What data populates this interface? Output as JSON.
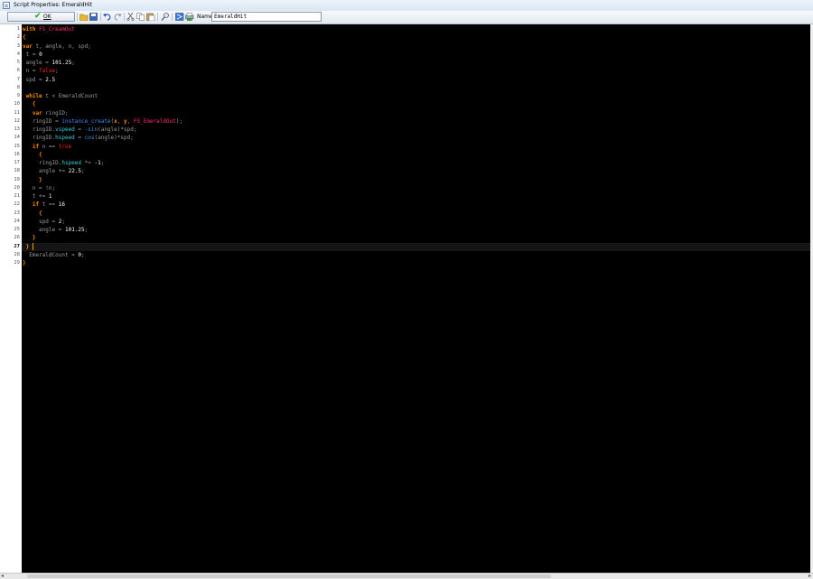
{
  "window": {
    "title": "Script Properties: EmeraldHit"
  },
  "toolbar": {
    "ok_label": "OK",
    "name_label": "Name:",
    "name_value": "EmeraldHit",
    "icons": [
      "open-icon",
      "save-icon",
      "undo-icon",
      "redo-icon",
      "cut-icon",
      "copy-icon",
      "paste-icon",
      "find-icon",
      "goto-line-icon",
      "print-icon"
    ]
  },
  "editor": {
    "current_line": 27,
    "colors": {
      "keyword": "#ff8a00",
      "number": "#ffffff",
      "object": "#ff2d6f",
      "constant": "#ff2020",
      "function": "#3d8bff",
      "variable": "#35d0e0",
      "plain": "#9a9a9a",
      "background": "#000000"
    },
    "lines": [
      [
        {
          "t": "with ",
          "c": "kw"
        },
        {
          "t": "FS_CreamOut",
          "c": "obj"
        }
      ],
      [
        {
          "t": "{",
          "c": "br"
        }
      ],
      [
        {
          "t": "var ",
          "c": "kw"
        },
        {
          "t": "t, angle, n, spd;",
          "c": "pl"
        }
      ],
      [
        {
          "t": " t = ",
          "c": "pl"
        },
        {
          "t": "0",
          "c": "num"
        }
      ],
      [
        {
          "t": " angle = ",
          "c": "pl"
        },
        {
          "t": "101.25",
          "c": "num"
        },
        {
          "t": ";",
          "c": "pl"
        }
      ],
      [
        {
          "t": " n = ",
          "c": "pl"
        },
        {
          "t": "false",
          "c": "cst"
        },
        {
          "t": ";",
          "c": "pl"
        }
      ],
      [
        {
          "t": " spd = ",
          "c": "pl"
        },
        {
          "t": "2.5",
          "c": "num"
        }
      ],
      [],
      [
        {
          "t": " while ",
          "c": "kw"
        },
        {
          "t": "t < EmeraldCount",
          "c": "pl"
        }
      ],
      [
        {
          "t": "   {",
          "c": "br"
        }
      ],
      [
        {
          "t": "   var ",
          "c": "kw"
        },
        {
          "t": "ringID;",
          "c": "pl"
        }
      ],
      [
        {
          "t": "   ringID = ",
          "c": "pl"
        },
        {
          "t": "instance_create",
          "c": "fn"
        },
        {
          "t": "(",
          "c": "pl"
        },
        {
          "t": "x",
          "c": "kw"
        },
        {
          "t": ", ",
          "c": "pl"
        },
        {
          "t": "y",
          "c": "kw"
        },
        {
          "t": ", ",
          "c": "pl"
        },
        {
          "t": "FS_EmeraldOut",
          "c": "obj"
        },
        {
          "t": ");",
          "c": "pl"
        }
      ],
      [
        {
          "t": "   ringID.",
          "c": "pl"
        },
        {
          "t": "vspeed",
          "c": "var"
        },
        {
          "t": " = ",
          "c": "pl"
        },
        {
          "t": "-sin",
          "c": "fn"
        },
        {
          "t": "(angle)*spd;",
          "c": "pl"
        }
      ],
      [
        {
          "t": "   ringID.",
          "c": "pl"
        },
        {
          "t": "hspeed",
          "c": "var"
        },
        {
          "t": " = ",
          "c": "pl"
        },
        {
          "t": "cos",
          "c": "fn"
        },
        {
          "t": "(angle)*spd;",
          "c": "pl"
        }
      ],
      [
        {
          "t": "   if ",
          "c": "kw"
        },
        {
          "t": "n == ",
          "c": "pl"
        },
        {
          "t": "true",
          "c": "cst"
        }
      ],
      [
        {
          "t": "     {",
          "c": "br"
        }
      ],
      [
        {
          "t": "     ringID.",
          "c": "pl"
        },
        {
          "t": "hspeed",
          "c": "var"
        },
        {
          "t": " *= ",
          "c": "pl"
        },
        {
          "t": "-1",
          "c": "num"
        },
        {
          "t": ";",
          "c": "pl"
        }
      ],
      [
        {
          "t": "     angle += ",
          "c": "pl"
        },
        {
          "t": "22.5",
          "c": "num"
        },
        {
          "t": ";",
          "c": "pl"
        }
      ],
      [
        {
          "t": "     }",
          "c": "br"
        }
      ],
      [
        {
          "t": "   n = !n;",
          "c": "pl"
        }
      ],
      [
        {
          "t": "   t += ",
          "c": "pl"
        },
        {
          "t": "1",
          "c": "num"
        }
      ],
      [
        {
          "t": "   if ",
          "c": "kw"
        },
        {
          "t": "t == ",
          "c": "pl"
        },
        {
          "t": "16",
          "c": "num"
        }
      ],
      [
        {
          "t": "     {",
          "c": "br"
        }
      ],
      [
        {
          "t": "     spd = ",
          "c": "pl"
        },
        {
          "t": "2",
          "c": "num"
        },
        {
          "t": ";",
          "c": "pl"
        }
      ],
      [
        {
          "t": "     angle = ",
          "c": "pl"
        },
        {
          "t": "101.25",
          "c": "num"
        },
        {
          "t": ";",
          "c": "pl"
        }
      ],
      [
        {
          "t": "   }",
          "c": "br"
        }
      ],
      [
        {
          "t": " }",
          "c": "br"
        }
      ],
      [
        {
          "t": "  EmeraldCount = ",
          "c": "pl"
        },
        {
          "t": "0",
          "c": "num"
        },
        {
          "t": ";",
          "c": "pl"
        }
      ],
      [
        {
          "t": "}",
          "c": "br"
        }
      ]
    ]
  }
}
